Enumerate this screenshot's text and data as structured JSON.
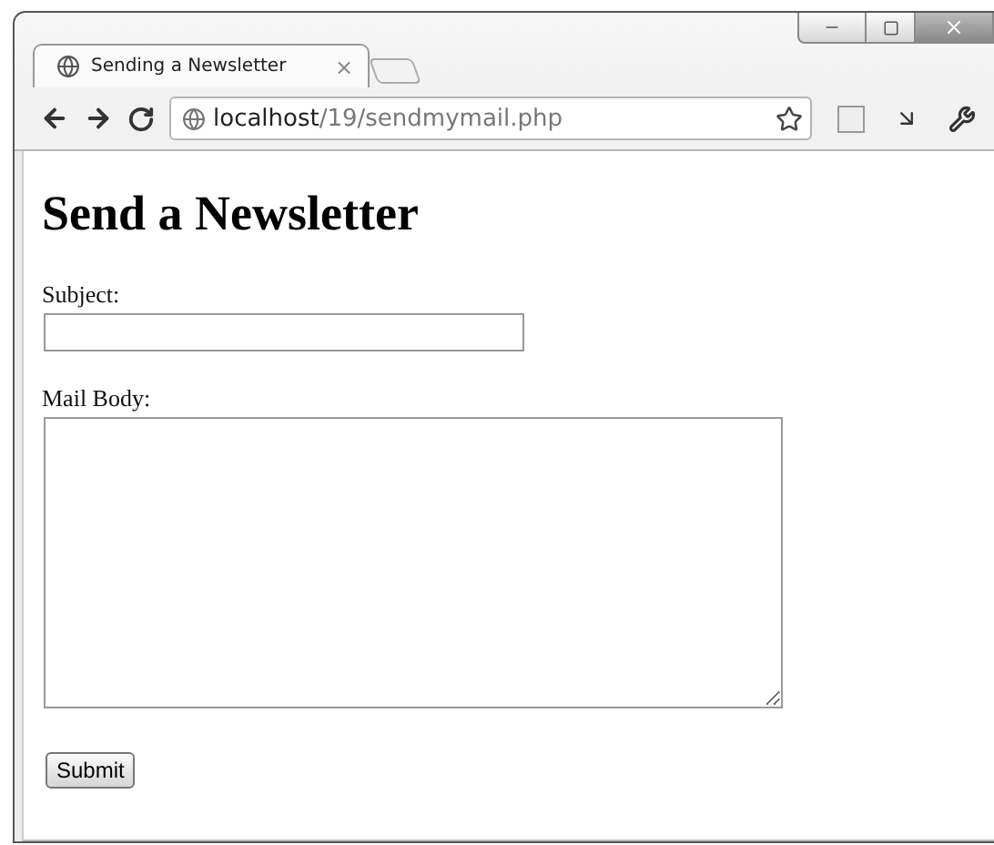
{
  "tabs": [
    {
      "title": "Sending a Newsletter",
      "close": "×",
      "selected": true
    }
  ],
  "address_bar": {
    "host": "localhost",
    "path": "/19/sendmymail.php"
  },
  "page": {
    "heading": "Send a Newsletter",
    "fields": [
      {
        "kind": "line",
        "label": "Subject:"
      },
      {
        "kind": "area",
        "label": "Mail Body:"
      }
    ],
    "submit": "Submit"
  }
}
